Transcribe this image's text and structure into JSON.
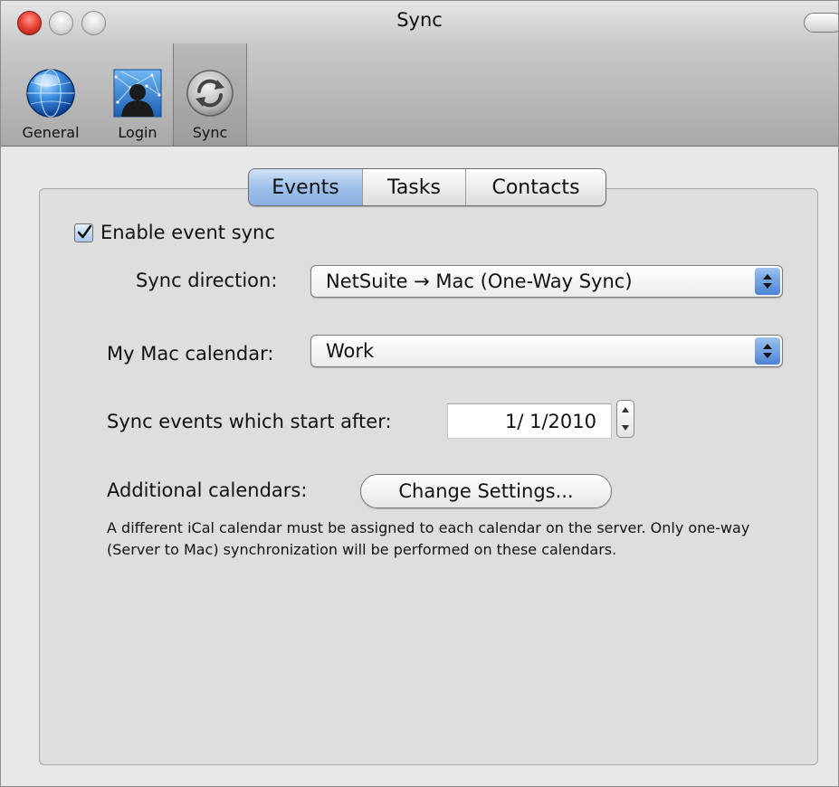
{
  "window": {
    "title": "Sync"
  },
  "toolbar": {
    "items": [
      {
        "label": "General",
        "icon": "globe-icon"
      },
      {
        "label": "Login",
        "icon": "user-network-icon"
      },
      {
        "label": "Sync",
        "icon": "sync-icon",
        "selected": true
      }
    ]
  },
  "tabs": [
    {
      "label": "Events",
      "active": true
    },
    {
      "label": "Tasks",
      "active": false
    },
    {
      "label": "Contacts",
      "active": false
    }
  ],
  "events": {
    "enable_label": "Enable event sync",
    "enable_checked": true,
    "sync_direction_label": "Sync direction:",
    "sync_direction_value": "NetSuite → Mac (One-Way Sync)",
    "calendar_label": "My Mac calendar:",
    "calendar_value": "Work",
    "start_after_label": "Sync events which start after:",
    "start_after_value": "1/  1/2010",
    "additional_label": "Additional calendars:",
    "change_settings_label": "Change Settings...",
    "help_text": "A different iCal calendar must be assigned to each calendar on the server. Only one-way (Server to Mac) synchronization will be performed on these calendars."
  },
  "colors": {
    "accent": "#86afe3",
    "close_button": "#e8463a",
    "popup_arrow": "#4b84d4"
  }
}
